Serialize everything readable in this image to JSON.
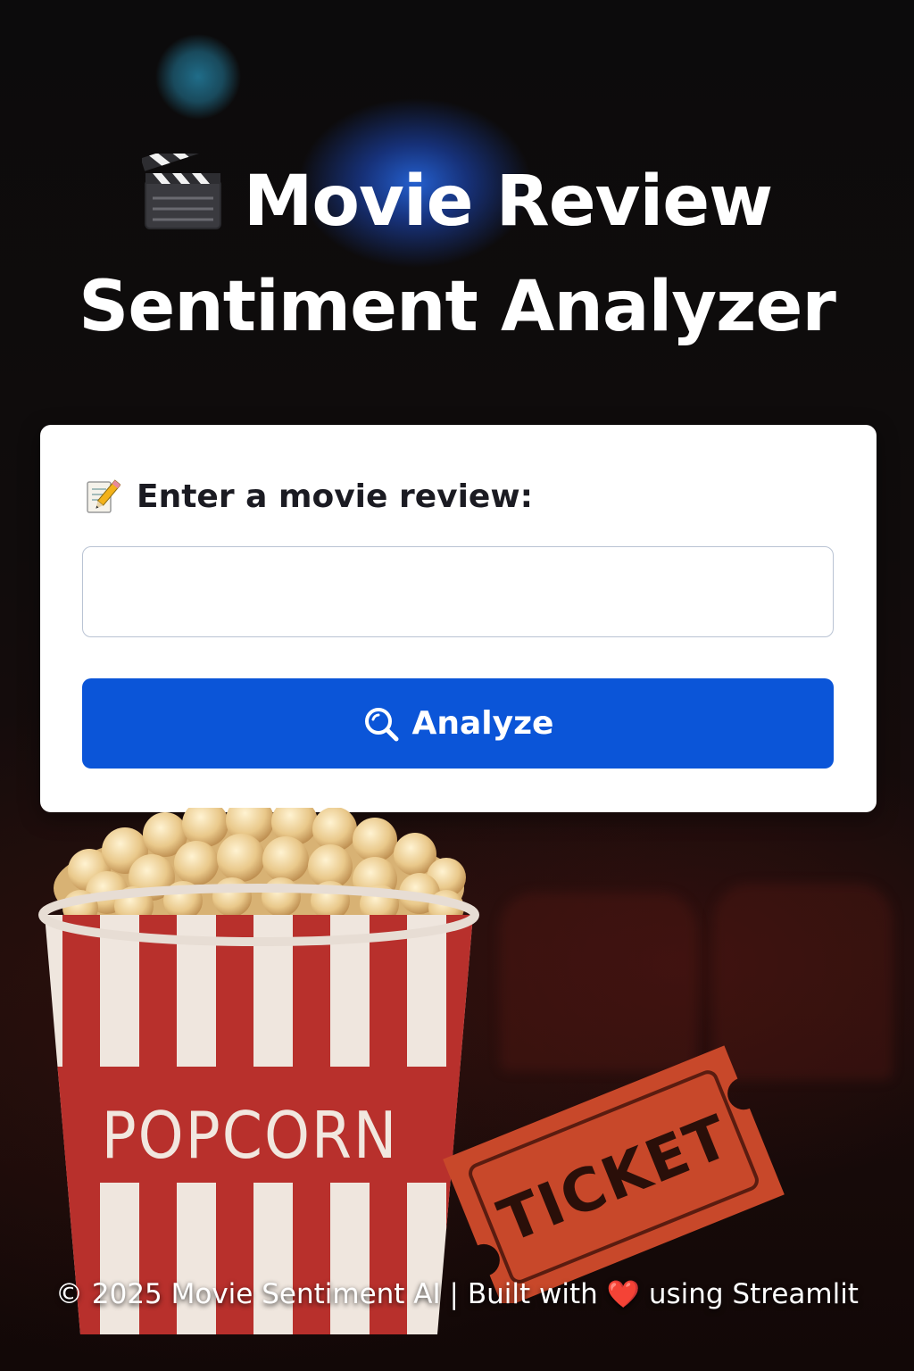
{
  "header": {
    "title_line1": "Movie Review",
    "title_line2": "Sentiment Analyzer",
    "title_icon": "clapper-board-icon"
  },
  "form": {
    "label": "Enter a movie review:",
    "label_icon": "memo-pencil-icon",
    "input_value": "",
    "input_placeholder": "",
    "button_label": "Analyze",
    "button_icon": "magnifier-icon"
  },
  "illustration": {
    "popcorn_text": "POPCORN",
    "ticket_text": "TICKET"
  },
  "footer": {
    "copyright": "© 2025 Movie Sentiment AI",
    "separator": "|",
    "built_prefix": "Built with",
    "heart": "❤️",
    "built_suffix": "using Streamlit"
  },
  "colors": {
    "accent": "#0b55d8",
    "card": "#ffffff",
    "background": "#0b0707",
    "popcorn_red": "#b8302c",
    "ticket_orange": "#c8482a"
  }
}
